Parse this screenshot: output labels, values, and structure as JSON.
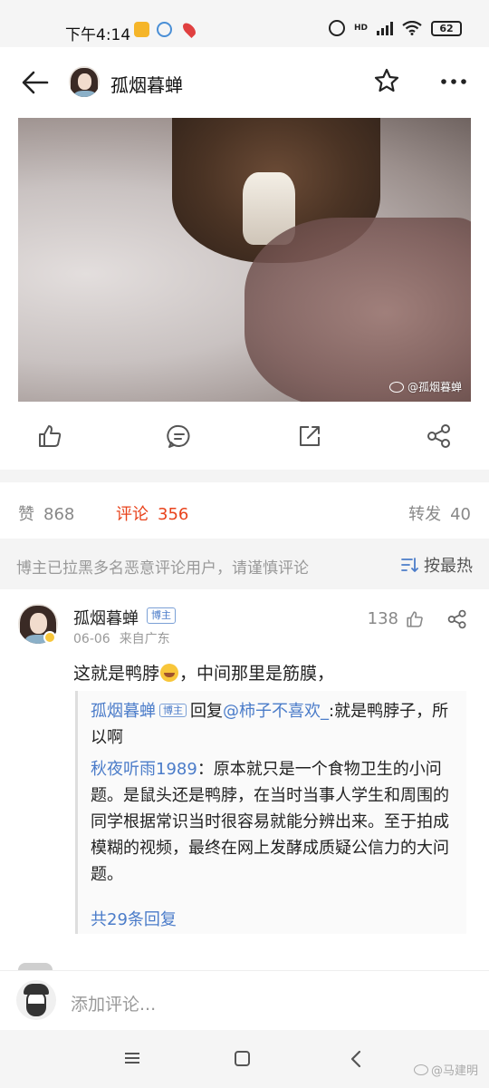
{
  "status_bar": {
    "time": "下午4:14",
    "network": "HD",
    "battery": "62"
  },
  "header": {
    "title": "孤烟暮蝉",
    "icons": [
      "back-arrow-icon",
      "star-icon",
      "more-icon"
    ]
  },
  "post": {
    "watermark": "@孤烟暮蝉",
    "actions": [
      "like-icon",
      "comment-icon",
      "forward-icon",
      "share-icon"
    ]
  },
  "stats": {
    "likes_label": "赞",
    "likes_count": "868",
    "comments_label": "评论",
    "comments_count": "356",
    "forwards_label": "转发",
    "forwards_count": "40"
  },
  "notice": {
    "text": "博主已拉黑多名恶意评论用户，请谨慎评论",
    "sort_label": "按最热"
  },
  "comment": {
    "author": "孤烟暮蝉",
    "author_tag": "博主",
    "date": "06-06",
    "location": "来自广东",
    "likes": "138",
    "body_before_emoji": "这就是鸭脖",
    "body_after_emoji": "，中间那里是筋膜，",
    "replies": [
      {
        "user": "孤烟暮蝉",
        "tag": "博主",
        "reply_word": "回复",
        "mention": "@柿子不喜欢_",
        "text": ":就是鸭脖子，所以啊"
      },
      {
        "user": "秋夜听雨1989",
        "text": "：原本就只是一个食物卫生的小问题。是鼠头还是鸭脖，在当时当事人学生和周围的同学根据常识当时很容易就能分辨出来。至于拍成模糊的视频，最终在网上发酵成质疑公信力的大问题。"
      }
    ],
    "more_replies": "共29条回复"
  },
  "compose": {
    "placeholder": "添加评论..."
  },
  "system_nav": {
    "watermark": "@马建明"
  },
  "colors": {
    "accent": "#e8431c",
    "link": "#4b7cc9",
    "muted": "#999999"
  }
}
